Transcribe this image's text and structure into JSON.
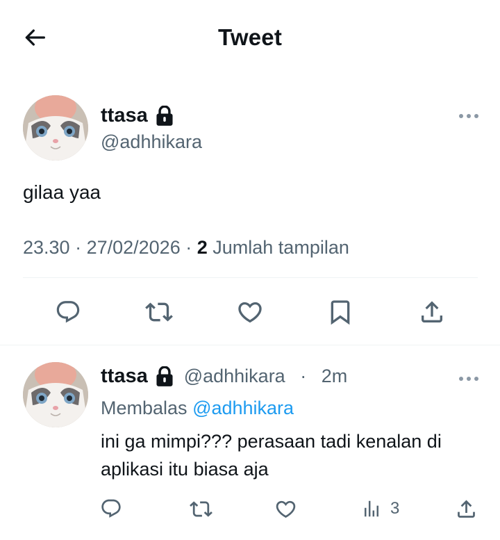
{
  "header": {
    "title": "Tweet"
  },
  "tweet": {
    "display_name": "ttasa",
    "handle": "@adhhikara",
    "text": "gilaa yaa",
    "time": "23.30",
    "date": "27/02/2026",
    "views_count": "2",
    "views_label": "Jumlah tampilan"
  },
  "reply": {
    "display_name": "ttasa",
    "handle": "@adhhikara",
    "time_ago": "2m",
    "replying_prefix": "Membalas",
    "replying_to": "@adhhikara",
    "text": "ini ga mimpi??? perasaan tadi kenalan di aplikasi itu biasa aja",
    "views_count": "3"
  },
  "colors": {
    "text_primary": "#0f1419",
    "text_secondary": "#536471",
    "accent": "#1d9bf0",
    "divider": "#eff3f4"
  },
  "icons": [
    "back-arrow-icon",
    "lock-icon",
    "more-icon",
    "reply-icon",
    "retweet-icon",
    "like-icon",
    "bookmark-icon",
    "share-icon",
    "views-icon"
  ]
}
